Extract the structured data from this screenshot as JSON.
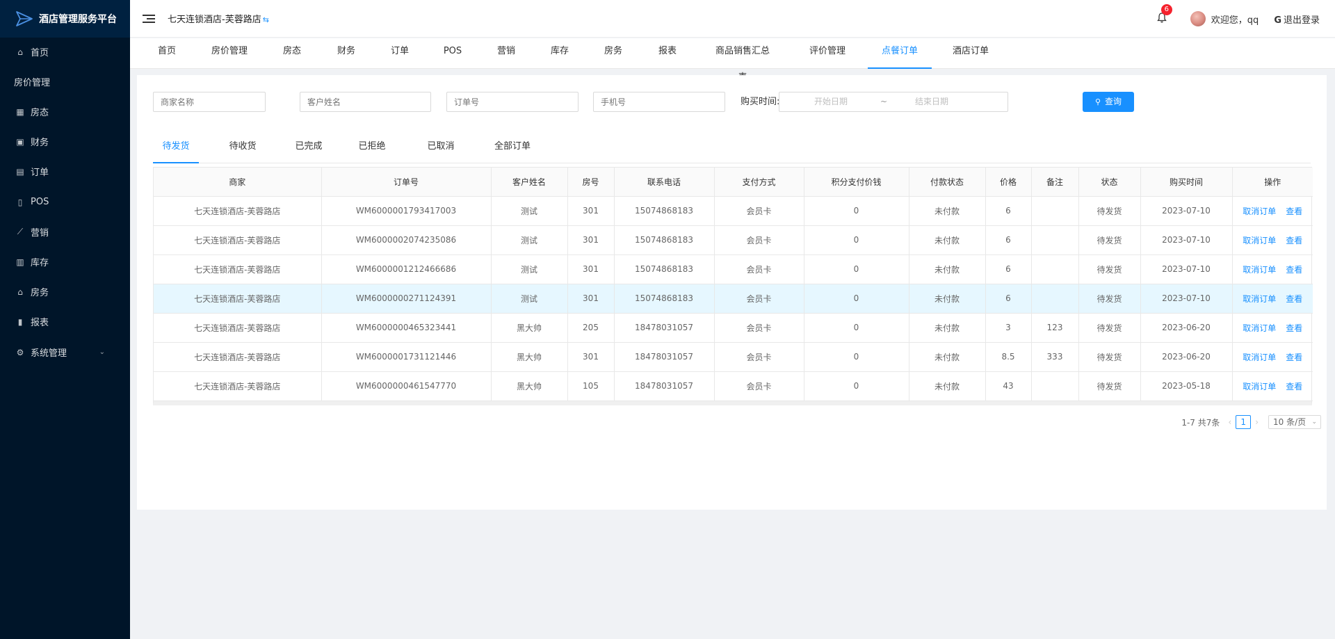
{
  "app": {
    "title": "酒店管理服务平台"
  },
  "sidebar": {
    "items": [
      {
        "label": "首页",
        "icon": "home-icon",
        "glyph": "⌂"
      },
      {
        "label": "房价管理",
        "icon": "",
        "glyph": ""
      },
      {
        "label": "房态",
        "icon": "grid-icon",
        "glyph": "▦"
      },
      {
        "label": "财务",
        "icon": "wallet-icon",
        "glyph": "▣"
      },
      {
        "label": "订单",
        "icon": "order-icon",
        "glyph": "▤"
      },
      {
        "label": "POS",
        "icon": "pos-icon",
        "glyph": "▯"
      },
      {
        "label": "营销",
        "icon": "chart-line-icon",
        "glyph": "⟋"
      },
      {
        "label": "库存",
        "icon": "inventory-icon",
        "glyph": "▥"
      },
      {
        "label": "房务",
        "icon": "bank-icon",
        "glyph": "⌂"
      },
      {
        "label": "报表",
        "icon": "bar-chart-icon",
        "glyph": "▮"
      },
      {
        "label": "系统管理",
        "icon": "gear-icon",
        "glyph": "⚙",
        "caret": "⌄"
      }
    ]
  },
  "header": {
    "hotel": "七天连锁酒店-芙蓉路店",
    "swap": "⇆",
    "notification_count": "6",
    "welcome": "欢迎您，qq",
    "logout": "退出登录"
  },
  "nav_tabs": [
    {
      "label": "首页",
      "active": false
    },
    {
      "label": "房价管理",
      "active": false
    },
    {
      "label": "房态",
      "active": false
    },
    {
      "label": "财务",
      "active": false
    },
    {
      "label": "订单",
      "active": false
    },
    {
      "label": "POS",
      "active": false
    },
    {
      "label": "营销",
      "active": false
    },
    {
      "label": "库存",
      "active": false
    },
    {
      "label": "房务",
      "active": false
    },
    {
      "label": "报表",
      "active": false
    },
    {
      "label": "商品销售汇总表",
      "active": false
    },
    {
      "label": "评价管理",
      "active": false
    },
    {
      "label": "点餐订单",
      "active": true
    },
    {
      "label": "酒店订单",
      "active": false
    }
  ],
  "filters": {
    "merchant_placeholder": "商家名称",
    "customer_placeholder": "客户姓名",
    "order_placeholder": "订单号",
    "phone_placeholder": "手机号",
    "time_label": "购买时间:",
    "start_placeholder": "开始日期",
    "separator": "~",
    "end_placeholder": "结束日期",
    "query_label": "查询"
  },
  "status_tabs": [
    {
      "label": "待发货",
      "active": true
    },
    {
      "label": "待收货",
      "active": false
    },
    {
      "label": "已完成",
      "active": false
    },
    {
      "label": "已拒绝",
      "active": false
    },
    {
      "label": "已取消",
      "active": false
    },
    {
      "label": "全部订单",
      "active": false
    }
  ],
  "table": {
    "columns": [
      "商家",
      "订单号",
      "客户姓名",
      "房号",
      "联系电话",
      "支付方式",
      "积分支付价钱",
      "付款状态",
      "价格",
      "备注",
      "状态",
      "购买时间",
      "操作"
    ],
    "rows": [
      [
        "七天连锁酒店-芙蓉路店",
        "WM6000001793417003",
        "测试",
        "301",
        "15074868183",
        "会员卡",
        "0",
        "未付款",
        "6",
        "",
        "待发货",
        "2023-07-10"
      ],
      [
        "七天连锁酒店-芙蓉路店",
        "WM6000002074235086",
        "测试",
        "301",
        "15074868183",
        "会员卡",
        "0",
        "未付款",
        "6",
        "",
        "待发货",
        "2023-07-10"
      ],
      [
        "七天连锁酒店-芙蓉路店",
        "WM6000001212466686",
        "测试",
        "301",
        "15074868183",
        "会员卡",
        "0",
        "未付款",
        "6",
        "",
        "待发货",
        "2023-07-10"
      ],
      [
        "七天连锁酒店-芙蓉路店",
        "WM6000000271124391",
        "测试",
        "301",
        "15074868183",
        "会员卡",
        "0",
        "未付款",
        "6",
        "",
        "待发货",
        "2023-07-10"
      ],
      [
        "七天连锁酒店-芙蓉路店",
        "WM6000000465323441",
        "黑大帅",
        "205",
        "18478031057",
        "会员卡",
        "0",
        "未付款",
        "3",
        "123",
        "待发货",
        "2023-06-20"
      ],
      [
        "七天连锁酒店-芙蓉路店",
        "WM6000001731121446",
        "黑大帅",
        "301",
        "18478031057",
        "会员卡",
        "0",
        "未付款",
        "8.5",
        "333",
        "待发货",
        "2023-06-20"
      ],
      [
        "七天连锁酒店-芙蓉路店",
        "WM6000000461547770",
        "黑大帅",
        "105",
        "18478031057",
        "会员卡",
        "0",
        "未付款",
        "43",
        "",
        "待发货",
        "2023-05-18"
      ]
    ],
    "highlight_row": 3,
    "actions": {
      "cancel": "取消订单",
      "view": "查看"
    }
  },
  "pagination": {
    "summary": "1-7 共7条",
    "prev": "‹",
    "current": "1",
    "next": "›",
    "page_size": "10 条/页",
    "size_caret": "⌄"
  },
  "colors": {
    "primary": "#1890ff",
    "sidebar_bg": "#001529",
    "highlight_row": "#e6f7ff"
  }
}
